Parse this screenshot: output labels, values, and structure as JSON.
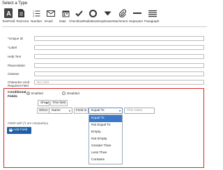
{
  "dialog": {
    "title": "Select a Type"
  },
  "types": [
    {
      "label": "TextField",
      "icon": "letter-a-icon"
    },
    {
      "label": "TextArea",
      "icon": "document-icon"
    },
    {
      "label": "Number",
      "icon": "numbered-list-icon"
    },
    {
      "label": "Email",
      "icon": "envelope-icon"
    },
    {
      "label": "Date",
      "icon": "calendar-icon"
    },
    {
      "label": "Checkbox",
      "icon": "checkmark-icon"
    },
    {
      "label": "RadioBox",
      "icon": "radio-circle-icon"
    },
    {
      "label": "DropDown",
      "icon": "caret-down-icon"
    },
    {
      "label": "Attachment",
      "icon": "paperclip-icon"
    },
    {
      "label": "Separator",
      "icon": "separator-line-icon"
    },
    {
      "label": "Paragraph",
      "icon": "paragraph-lines-icon"
    }
  ],
  "fields": {
    "unique_id": {
      "label": "*Unique ID",
      "value": ""
    },
    "label": {
      "label": "*Label",
      "value": ""
    },
    "help_text": {
      "label": "Help Text",
      "value": ""
    },
    "placeholder": {
      "label": "PlaceHolder",
      "value": ""
    },
    "classes": {
      "label": "Classes",
      "value": ""
    },
    "char_limit": {
      "label": "Character Limit",
      "placeholder": "No Limit"
    },
    "required": {
      "label": "Required Field"
    }
  },
  "conditional": {
    "label": "Conditional Fields",
    "enabled_label": "Enabled",
    "disabled_label": "Disabled",
    "selected": "Enabled",
    "action_value": "Show",
    "this_field": "This field",
    "when": "When",
    "field_value": "Name",
    "field_is": "Field is",
    "operator_value": "Equal To",
    "value_placeholder": "This Value",
    "operators": [
      "Equal To",
      "Not Equal To",
      "Empty",
      "Not Empty",
      "Greater Than",
      "Less Than",
      "Contains"
    ],
    "highlighted_operator": "Equal To"
  },
  "footer": {
    "note": "Fields with (*) are compulsory.",
    "add_field": "Add Field"
  },
  "colors": {
    "accent": "#1f5fa8",
    "highlight": "#3b78c5",
    "border_red": "#dd2222"
  }
}
